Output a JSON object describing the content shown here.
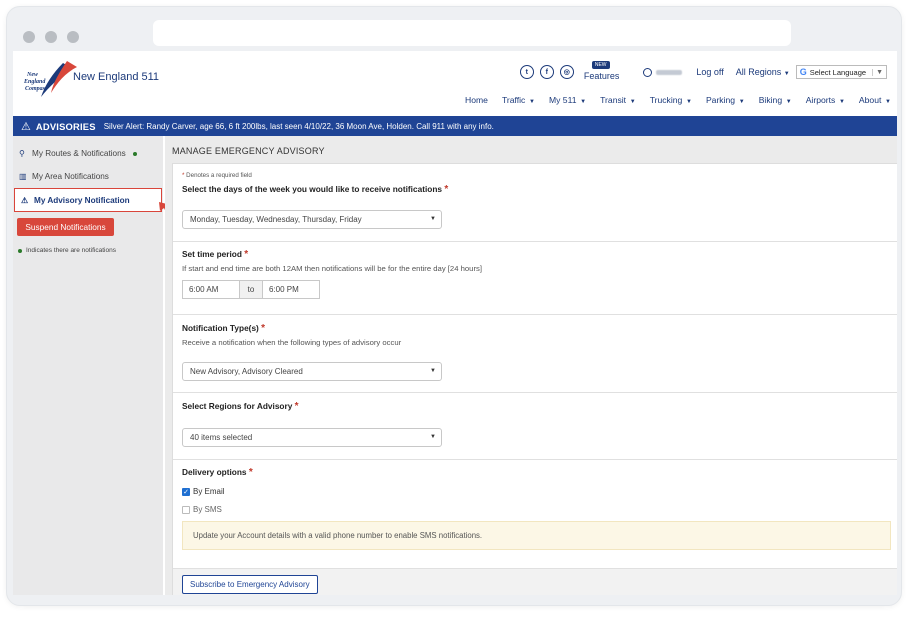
{
  "header": {
    "logo_text": "New England 511",
    "logo_mark": "New England Compass",
    "features_badge": "NEW",
    "features_label": "Features",
    "logoff_label": "Log off",
    "regions_label": "All Regions",
    "language_label": "Select Language"
  },
  "nav": {
    "items": [
      {
        "label": "Home",
        "caret": false
      },
      {
        "label": "Traffic",
        "caret": true
      },
      {
        "label": "My 511",
        "caret": true
      },
      {
        "label": "Transit",
        "caret": true
      },
      {
        "label": "Trucking",
        "caret": true
      },
      {
        "label": "Parking",
        "caret": true
      },
      {
        "label": "Biking",
        "caret": true
      },
      {
        "label": "Airports",
        "caret": true
      },
      {
        "label": "About",
        "caret": true
      }
    ]
  },
  "advisory": {
    "label": "ADVISORIES",
    "text": "Silver Alert: Randy Carver, age 66, 6 ft 200lbs, last seen 4/10/22, 36 Moon Ave, Holden. Call 911 with any info."
  },
  "sidebar": {
    "items": [
      {
        "label": "My Routes & Notifications",
        "icon": "route-icon",
        "has_dot": true
      },
      {
        "label": "My Area Notifications",
        "icon": "map-icon",
        "has_dot": false
      },
      {
        "label": "My Advisory Notification",
        "icon": "warning-icon",
        "has_dot": false
      }
    ],
    "suspend_label": "Suspend Notifications",
    "legend_text": "Indicates there are notifications"
  },
  "form": {
    "title": "MANAGE EMERGENCY ADVISORY",
    "required_note": "Denotes a required field",
    "days": {
      "label": "Select the days of the week you would like to receive notifications",
      "value": "Monday, Tuesday, Wednesday, Thursday, Friday"
    },
    "time": {
      "label": "Set time period",
      "help": "If start and end time are both 12AM then notifications will be for the entire day [24 hours]",
      "start": "6:00 AM",
      "to": "to",
      "end": "6:00 PM"
    },
    "types": {
      "label": "Notification Type(s)",
      "help": "Receive a notification when the following types of advisory occur",
      "value": "New Advisory, Advisory Cleared"
    },
    "regions": {
      "label": "Select Regions for Advisory",
      "value": "40 items selected"
    },
    "delivery": {
      "label": "Delivery options",
      "email_label": "By Email",
      "email_checked": true,
      "sms_label": "By SMS",
      "sms_checked": false,
      "notice": "Update your Account details with a valid phone number to enable SMS notifications."
    },
    "submit_label": "Subscribe to Emergency Advisory"
  },
  "colors": {
    "brand_blue": "#1f4495",
    "alert_red": "#d8473b",
    "notice_bg": "#fcf7e6"
  }
}
